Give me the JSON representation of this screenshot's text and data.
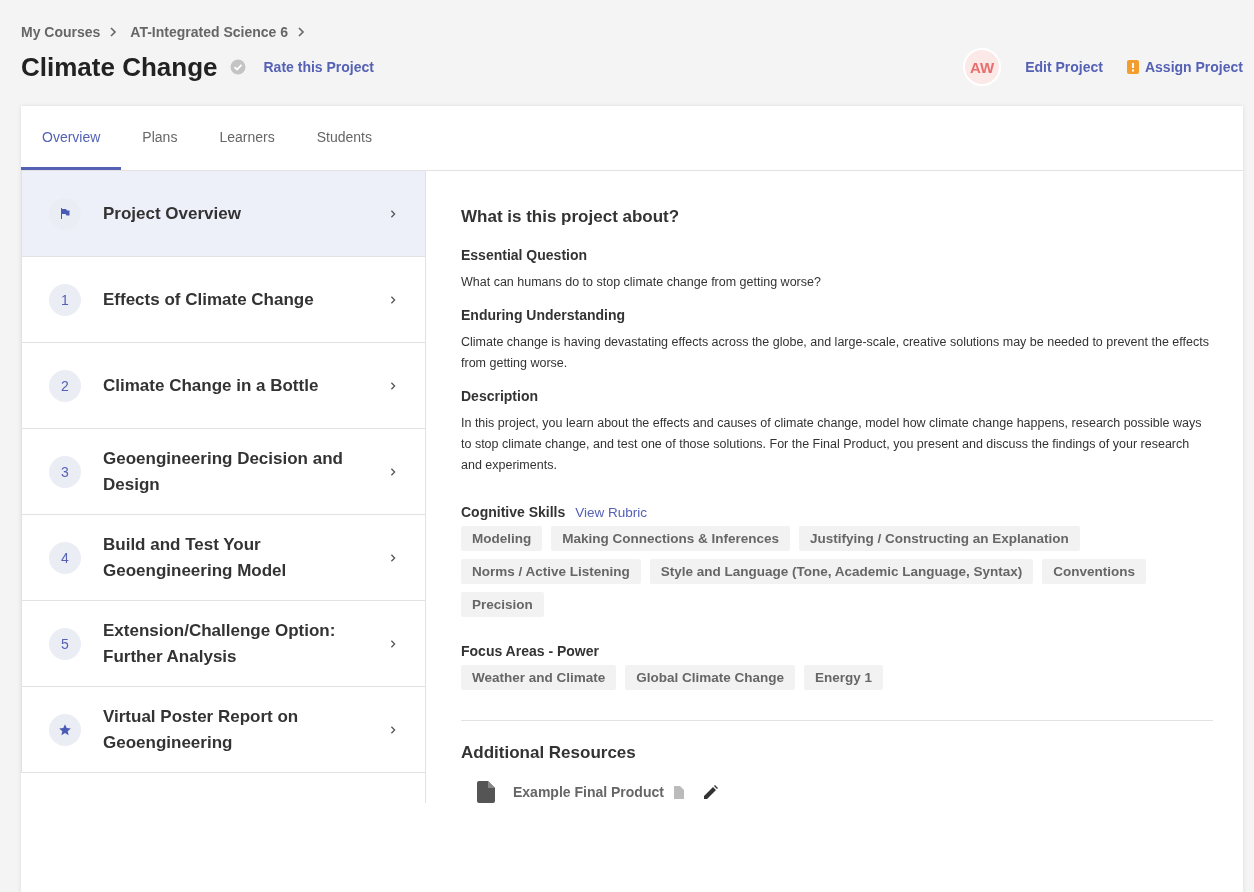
{
  "breadcrumb": [
    "My Courses",
    "AT-Integrated Science 6"
  ],
  "title": "Climate Change",
  "rate_link": "Rate this Project",
  "avatar": {
    "initials": "AW"
  },
  "actions": [
    {
      "label": "Edit Project",
      "kind": "plain"
    },
    {
      "label": "Assign Project",
      "kind": "alert"
    }
  ],
  "tabs": [
    {
      "label": "Overview",
      "selected": true
    },
    {
      "label": "Plans",
      "selected": false
    },
    {
      "label": "Learners",
      "selected": false
    },
    {
      "label": "Students",
      "selected": false
    }
  ],
  "sidebar": {
    "items": [
      {
        "kind": "flag",
        "label": "Project Overview",
        "selected": true
      },
      {
        "kind": "number",
        "number": "1",
        "label": "Effects of Climate Change",
        "selected": false
      },
      {
        "kind": "number",
        "number": "2",
        "label": "Climate Change in a Bottle",
        "selected": false
      },
      {
        "kind": "number",
        "number": "3",
        "label": "Geoengineering Decision and Design",
        "selected": false
      },
      {
        "kind": "number",
        "number": "4",
        "label": "Build and Test Your Geoengineering Model",
        "selected": false
      },
      {
        "kind": "number",
        "number": "5",
        "label": "Extension/Challenge Option: Further Analysis",
        "selected": false
      },
      {
        "kind": "star",
        "label": "Virtual Poster Report on Geoengineering",
        "selected": false
      }
    ]
  },
  "content": {
    "heading": "What is this project about?",
    "sections": [
      {
        "title": "Essential Question",
        "text": "What can humans do to stop climate change from getting worse?"
      },
      {
        "title": "Enduring Understanding",
        "text": "Climate change is having devastating effects across the globe, and large-scale, creative solutions may be needed to prevent the effects from getting worse."
      },
      {
        "title": "Description",
        "text": "In this project, you learn about the effects and causes of climate change, model how climate change happens, research possible ways to stop climate change, and test one of those solutions.  For the Final Product, you present and discuss the findings of your research and experiments."
      }
    ],
    "tag_groups": [
      {
        "title": "Cognitive Skills",
        "link": "View Rubric",
        "tags": [
          "Modeling",
          "Making Connections & Inferences",
          "Justifying / Constructing an Explanation",
          "Norms / Active Listening",
          "Style and Language (Tone, Academic Language, Syntax)",
          "Conventions",
          "Precision"
        ]
      },
      {
        "title": "Focus Areas - Power",
        "tags": [
          "Weather and Climate",
          "Global Climate Change",
          "Energy 1"
        ]
      }
    ],
    "resources": {
      "heading": "Additional Resources",
      "items": [
        "Example Final Product"
      ]
    }
  }
}
